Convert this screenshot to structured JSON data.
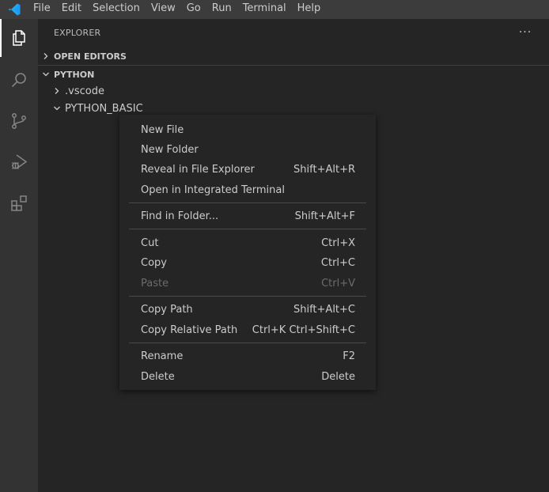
{
  "titlebar": {
    "logo_icon": "vscode-logo-icon",
    "menus": [
      "File",
      "Edit",
      "Selection",
      "View",
      "Go",
      "Run",
      "Terminal",
      "Help"
    ]
  },
  "activitybar": {
    "items": [
      "explorer-icon",
      "search-icon",
      "source-control-icon",
      "run-debug-icon",
      "extensions-icon"
    ],
    "active": "explorer-icon"
  },
  "sidebar": {
    "title": "EXPLORER",
    "more_actions": "···",
    "open_editors": "OPEN EDITORS",
    "workspace": "PYTHON",
    "tree": [
      {
        "label": ".vscode",
        "expanded": false
      },
      {
        "label": "PYTHON_BASIC",
        "expanded": true
      }
    ]
  },
  "context_menu": {
    "groups": [
      [
        {
          "label": "New File",
          "shortcut": ""
        },
        {
          "label": "New Folder",
          "shortcut": ""
        },
        {
          "label": "Reveal in File Explorer",
          "shortcut": "Shift+Alt+R"
        },
        {
          "label": "Open in Integrated Terminal",
          "shortcut": ""
        }
      ],
      [
        {
          "label": "Find in Folder...",
          "shortcut": "Shift+Alt+F"
        }
      ],
      [
        {
          "label": "Cut",
          "shortcut": "Ctrl+X"
        },
        {
          "label": "Copy",
          "shortcut": "Ctrl+C"
        },
        {
          "label": "Paste",
          "shortcut": "Ctrl+V",
          "disabled": true
        }
      ],
      [
        {
          "label": "Copy Path",
          "shortcut": "Shift+Alt+C"
        },
        {
          "label": "Copy Relative Path",
          "shortcut": "Ctrl+K Ctrl+Shift+C"
        }
      ],
      [
        {
          "label": "Rename",
          "shortcut": "F2"
        },
        {
          "label": "Delete",
          "shortcut": "Delete"
        }
      ]
    ]
  },
  "colors": {
    "titlebar": "#3c3c3c",
    "activitybar": "#333333",
    "sidebar": "#252526",
    "text": "#cccccc",
    "disabled_text": "#6b6b6b",
    "logo_blue": "#23a9f2"
  }
}
